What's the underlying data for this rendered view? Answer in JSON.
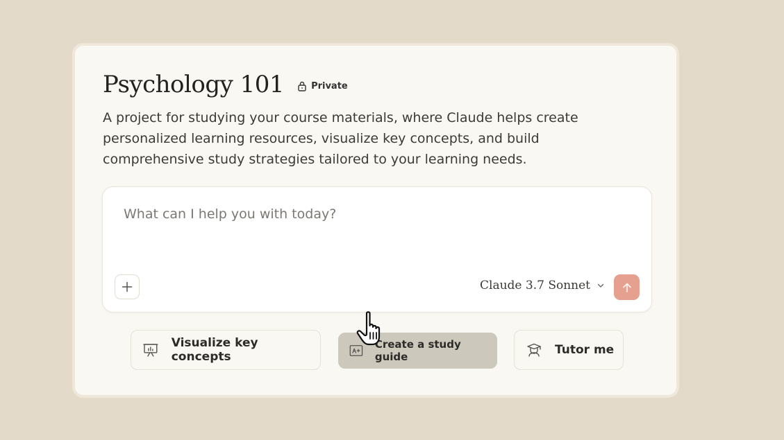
{
  "project": {
    "title": "Psychology 101",
    "visibility_label": "Private",
    "description": [
      "A project for studying your course materials, where Claude helps create",
      "personalized learning resources, visualize key concepts, and build",
      "comprehensive study strategies tailored to your learning needs."
    ]
  },
  "composer": {
    "placeholder": "What can I help you with today?",
    "model_label": "Claude 3.7 Sonnet",
    "icons": {
      "add": "plus-icon",
      "model_menu": "chevron-down-icon",
      "send": "arrow-up-icon"
    },
    "send_color": "#e5a08f"
  },
  "suggestions": [
    {
      "label": "Visualize key concepts",
      "icon": "presentation-chart-icon"
    },
    {
      "label": "Create a study guide",
      "icon": "grade-document-icon",
      "hovered": true
    },
    {
      "label": "Tutor me",
      "icon": "graduate-icon"
    }
  ],
  "colors": {
    "background": "#e4dac9",
    "card": "#faf8f3",
    "hover_chip": "#ccc8bc"
  },
  "pointer": "hand-pointer-icon"
}
